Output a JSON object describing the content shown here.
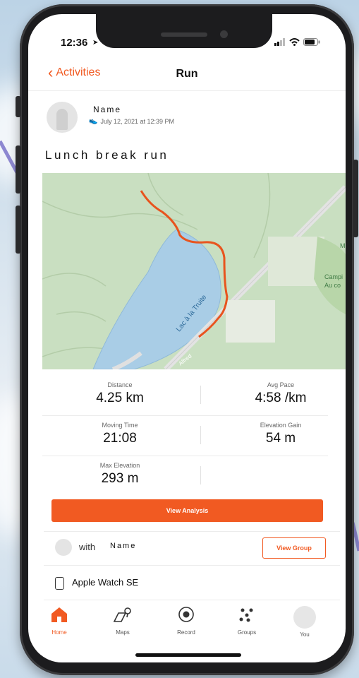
{
  "status_bar": {
    "time": "12:36"
  },
  "nav": {
    "back_label": "Activities",
    "title": "Run"
  },
  "activity": {
    "athlete_name": "Name",
    "date": "July 12, 2021 at 12:39 PM",
    "title": "Lunch break run"
  },
  "map": {
    "lake_label": "Lac à la Truite",
    "place_label_1": "Campi",
    "place_label_2": "Au co",
    "place_label_3": "M",
    "road_label": "Alfred"
  },
  "stats": [
    {
      "label": "Distance",
      "value": "4.25 km"
    },
    {
      "label": "Avg Pace",
      "value": "4:58 /km"
    },
    {
      "label": "Moving Time",
      "value": "21:08"
    },
    {
      "label": "Elevation Gain",
      "value": "54 m"
    },
    {
      "label": "Max Elevation",
      "value": "293 m"
    }
  ],
  "actions": {
    "view_analysis": "View Analysis",
    "view_group": "View Group"
  },
  "group": {
    "with_label": "with",
    "name": "Name"
  },
  "device": {
    "name": "Apple Watch SE"
  },
  "tabs": [
    {
      "label": "Home",
      "icon": "home-icon"
    },
    {
      "label": "Maps",
      "icon": "map-icon"
    },
    {
      "label": "Record",
      "icon": "record-icon"
    },
    {
      "label": "Groups",
      "icon": "groups-icon"
    },
    {
      "label": "You",
      "icon": "profile-icon"
    }
  ],
  "colors": {
    "accent": "#f15a22",
    "water": "#a9cde6",
    "land": "#c9dfc1",
    "route": "#e8541e"
  }
}
